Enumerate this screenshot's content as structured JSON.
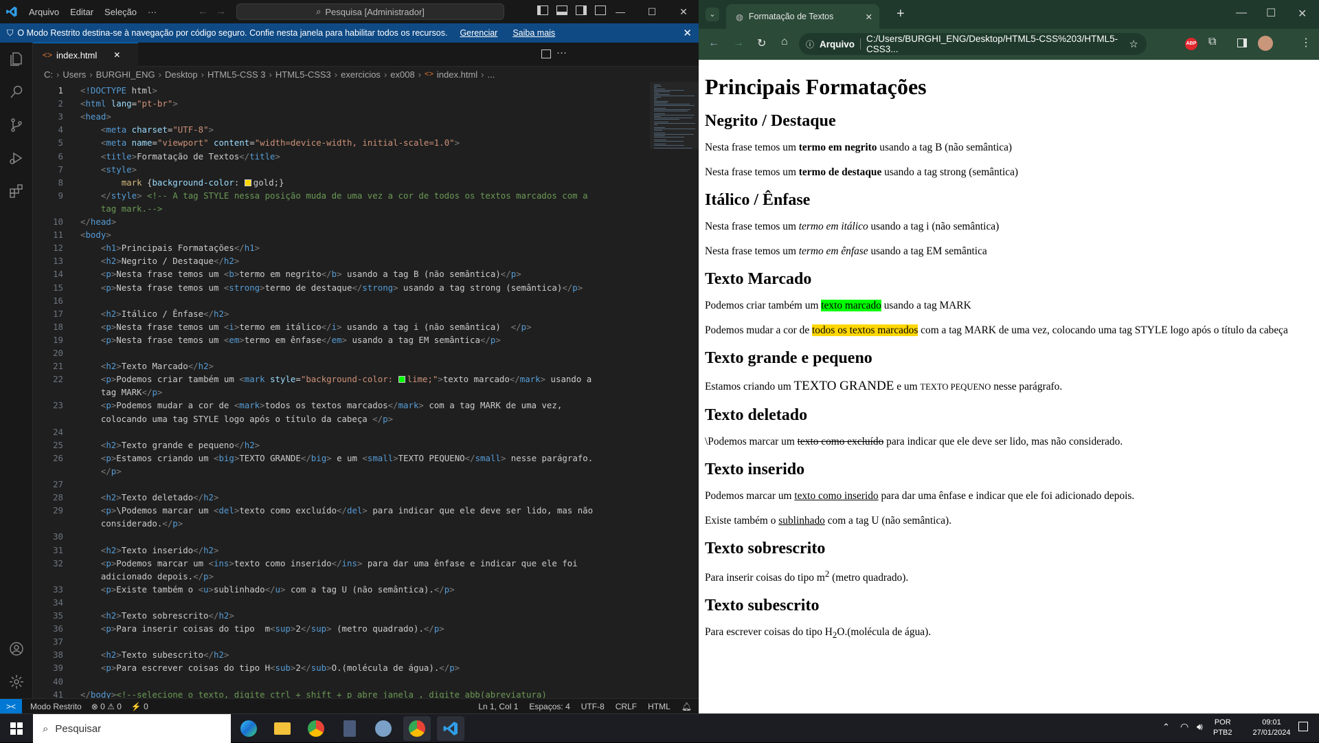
{
  "vscode": {
    "menu": [
      "Arquivo",
      "Editar",
      "Seleção",
      "···"
    ],
    "search": "Pesquisa [Administrador]",
    "banner": {
      "text": "O Modo Restrito destina-se à navegação por código seguro. Confie nesta janela para habilitar todos os recursos.",
      "link1": "Gerenciar",
      "link2": "Saiba mais"
    },
    "tab": "index.html",
    "breadcrumb": [
      "C:",
      "Users",
      "BURGHI_ENG",
      "Desktop",
      "HTML5-CSS 3",
      "HTML5-CSS3",
      "exercicios",
      "ex008",
      "index.html",
      "..."
    ],
    "status": {
      "remote": "><",
      "mode": "Modo Restrito",
      "errors": "⊗ 0 ⚠ 0",
      "ports": "⚡ 0",
      "position": "Ln 1, Col 1",
      "spaces": "Espaços: 4",
      "encoding": "UTF-8",
      "eol": "CRLF",
      "language": "HTML"
    },
    "line_numbers": [
      "1",
      "2",
      "3",
      "4",
      "5",
      "6",
      "7",
      "8",
      "9",
      "",
      "10",
      "11",
      "12",
      "13",
      "14",
      "15",
      "16",
      "17",
      "18",
      "19",
      "20",
      "21",
      "22",
      "",
      "23",
      "",
      "24",
      "25",
      "26",
      "",
      "27",
      "28",
      "29",
      "",
      "30",
      "31",
      "32",
      "",
      "33",
      "34",
      "35",
      "36",
      "37",
      "38",
      "39",
      "40",
      "41"
    ],
    "code_lines": [
      "<!DOCTYPE html>",
      "<html lang=\"pt-br\">",
      "<head>",
      "    <meta charset=\"UTF-8\">",
      "    <meta name=\"viewport\" content=\"width=device-width, initial-scale=1.0\">",
      "    <title>Formatação de Textos</title>",
      "    <style>",
      "        mark {background-color: ■gold;}",
      "    </style> <!-- A tag STYLE nessa posição muda de uma vez a cor de todos os textos marcados com a",
      "    tag mark.-->",
      "</head>",
      "<body>",
      "    <h1>Principais Formatações</h1>",
      "    <h2>Negrito / Destaque</h2>",
      "    <p>Nesta frase temos um <b>termo em negrito</b> usando a tag B (não semântica)</p>",
      "    <p>Nesta frase temos um <strong>termo de destaque</strong> usando a tag strong (semântica)</p>",
      "",
      "    <h2>Itálico / Ênfase</h2>",
      "    <p>Nesta frase temos um <i>termo em itálico</i> usando a tag i (não semântica)  </p>",
      "    <p>Nesta frase temos um <em>termo em ênfase</em> usando a tag EM semântica</p>",
      "",
      "    <h2>Texto Marcado</h2>",
      "    <p>Podemos criar também um <mark style=\"background-color: ■lime;\">texto marcado</mark> usando a",
      "    tag MARK</p>",
      "    <p>Podemos mudar a cor de <mark>todos os textos marcados</mark> com a tag MARK de uma vez,",
      "    colocando uma tag STYLE logo após o título da cabeça </p>",
      "",
      "    <h2>Texto grande e pequeno</h2>",
      "    <p>Estamos criando um <big>TEXTO GRANDE</big> e um <small>TEXTO PEQUENO</small> nesse parágrafo.",
      "    </p>",
      "",
      "    <h2>Texto deletado</h2>",
      "    <p>\\Podemos marcar um <del>texto como excluído</del> para indicar que ele deve ser lido, mas não",
      "    considerado.</p>",
      "",
      "    <h2>Texto inserido</h2>",
      "    <p>Podemos marcar um <ins>texto como inserido</ins> para dar uma ênfase e indicar que ele foi",
      "    adicionado depois.</p>",
      "    <p>Existe também o <u>sublinhado</u> com a tag U (não semântica).</p>",
      "",
      "    <h2>Texto sobrescrito</h2>",
      "    <p>Para inserir coisas do tipo  m<sup>2</sup> (metro quadrado).</p>",
      "",
      "    <h2>Texto subescrito</h2>",
      "    <p>Para escrever coisas do tipo H<sub>2</sub>O.(molécula de água).</p>",
      "",
      "</body><!--selecione o texto, digite ctrl + shift + p abre janela , digite abb(abreviatura)"
    ]
  },
  "chrome": {
    "tab_title": "Formatação de Textos",
    "omnibox_label": "Arquivo",
    "url": "C:/Users/BURGHI_ENG/Desktop/HTML5-CSS%203/HTML5-CSS3...",
    "page": {
      "h1": "Principais Formatações",
      "s1": {
        "h2": "Negrito / Destaque",
        "p1_a": "Nesta frase temos um ",
        "p1_b": "termo em negrito",
        "p1_c": " usando a tag B (não semântica)",
        "p2_a": "Nesta frase temos um ",
        "p2_b": "termo de destaque",
        "p2_c": " usando a tag strong (semântica)"
      },
      "s2": {
        "h2": "Itálico / Ênfase",
        "p1_a": "Nesta frase temos um ",
        "p1_b": "termo em itálico",
        "p1_c": " usando a tag i (não semântica)",
        "p2_a": "Nesta frase temos um ",
        "p2_b": "termo em ênfase",
        "p2_c": " usando a tag EM semântica"
      },
      "s3": {
        "h2": "Texto Marcado",
        "p1_a": "Podemos criar também um ",
        "p1_b": "texto marcado",
        "p1_c": " usando a tag MARK",
        "p2_a": "Podemos mudar a cor de ",
        "p2_b": "todos os textos marcados",
        "p2_c": " com a tag MARK de uma vez, colocando uma tag STYLE logo após o título da cabeça",
        "lime": "#00ff00",
        "gold": "#ffd700"
      },
      "s4": {
        "h2": "Texto grande e pequeno",
        "p_a": "Estamos criando um ",
        "p_b": "TEXTO GRANDE",
        "p_c": " e um ",
        "p_d": "TEXTO PEQUENO",
        "p_e": " nesse parágrafo."
      },
      "s5": {
        "h2": "Texto deletado",
        "p_a": "\\Podemos marcar um ",
        "p_b": "texto como excluído",
        "p_c": " para indicar que ele deve ser lido, mas não considerado."
      },
      "s6": {
        "h2": "Texto inserido",
        "p1_a": "Podemos marcar um ",
        "p1_b": "texto como inserido",
        "p1_c": " para dar uma ênfase e indicar que ele foi adicionado depois.",
        "p2_a": "Existe também o ",
        "p2_b": "sublinhado",
        "p2_c": " com a tag U (não semântica)."
      },
      "s7": {
        "h2": "Texto sobrescrito",
        "p_a": "Para inserir coisas do tipo m",
        "p_b": "2",
        "p_c": " (metro quadrado)."
      },
      "s8": {
        "h2": "Texto subescrito",
        "p_a": "Para escrever coisas do tipo H",
        "p_b": "2",
        "p_c": "O.(molécula de água)."
      }
    }
  },
  "taskbar": {
    "search": "Pesquisar",
    "lang1": "POR",
    "lang2": "PTB2",
    "time": "09:01",
    "date": "27/01/2024"
  },
  "colors": {
    "vscode_accent": "#0078d4",
    "banner": "#0f4a85",
    "chrome_frame": "#2b4a38"
  }
}
